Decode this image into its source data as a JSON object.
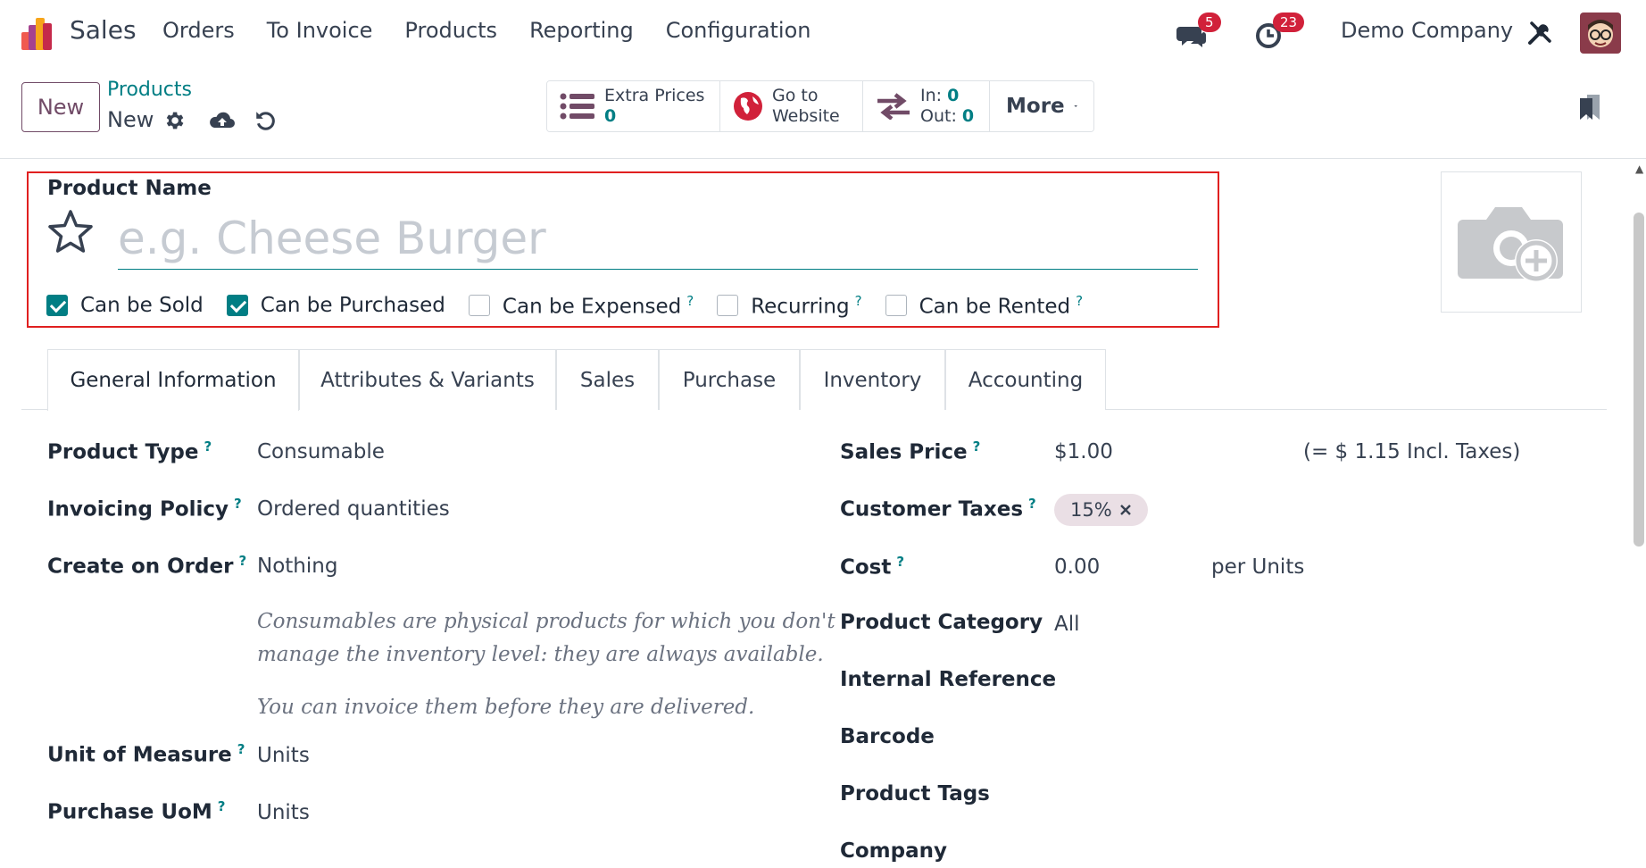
{
  "app": {
    "name": "Sales",
    "menu": [
      "Orders",
      "To Invoice",
      "Products",
      "Reporting",
      "Configuration"
    ],
    "messages_count": "5",
    "activities_count": "23",
    "company": "Demo Company"
  },
  "control_panel": {
    "new_label": "New",
    "breadcrumb_parent": "Products",
    "breadcrumb_current": "New",
    "smart_buttons": {
      "extra_prices_label": "Extra Prices",
      "extra_prices_value": "0",
      "website_line1": "Go to",
      "website_line2": "Website",
      "in_label": "In:",
      "in_value": "0",
      "out_label": "Out:",
      "out_value": "0",
      "more_label": "More"
    }
  },
  "form": {
    "product_name_label": "Product Name",
    "product_name_placeholder": "e.g. Cheese Burger",
    "checkboxes": [
      {
        "label": "Can be Sold",
        "checked": true,
        "help": ""
      },
      {
        "label": "Can be Purchased",
        "checked": true,
        "help": ""
      },
      {
        "label": "Can be Expensed",
        "checked": false,
        "help": "?"
      },
      {
        "label": "Recurring",
        "checked": false,
        "help": "?"
      },
      {
        "label": "Can be Rented",
        "checked": false,
        "help": "?"
      }
    ],
    "tabs": [
      "General Information",
      "Attributes & Variants",
      "Sales",
      "Purchase",
      "Inventory",
      "Accounting"
    ],
    "left_fields": {
      "product_type_label": "Product Type",
      "product_type_value": "Consumable",
      "invoicing_policy_label": "Invoicing Policy",
      "invoicing_policy_value": "Ordered quantities",
      "create_on_order_label": "Create on Order",
      "create_on_order_value": "Nothing",
      "note_line1": "Consumables are physical products for which you don't",
      "note_line2": "manage the inventory level: they are always available.",
      "note_line3": "You can invoice them before they are delivered.",
      "uom_label": "Unit of Measure",
      "uom_value": "Units",
      "purchase_uom_label": "Purchase UoM",
      "purchase_uom_value": "Units"
    },
    "right_fields": {
      "sales_price_label": "Sales Price",
      "sales_price_value": "$1.00",
      "sales_price_incl": "(= $ 1.15 Incl. Taxes)",
      "customer_taxes_label": "Customer Taxes",
      "customer_taxes_tag": "15%",
      "cost_label": "Cost",
      "cost_value": "0.00",
      "cost_unit": "per Units",
      "category_label": "Product Category",
      "category_value": "All",
      "internal_ref_label": "Internal Reference",
      "barcode_label": "Barcode",
      "tags_label": "Product Tags",
      "company_label": "Company"
    },
    "help_mark": "?"
  },
  "colors": {
    "brand": "#714b67",
    "accent": "#017e84",
    "badge": "#d1213a",
    "highlight": "#e02020"
  }
}
